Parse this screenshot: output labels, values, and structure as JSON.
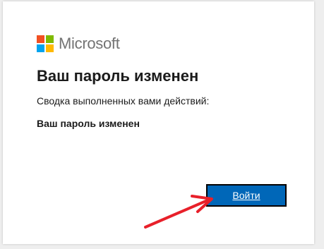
{
  "brand": {
    "name": "Microsoft",
    "colors": {
      "red": "#f25022",
      "green": "#7fba00",
      "blue": "#00a4ef",
      "yellow": "#ffb900"
    }
  },
  "main": {
    "title": "Ваш пароль изменен",
    "summary_label": "Сводка выполненных вами действий:",
    "action_item": "Ваш пароль изменен"
  },
  "buttons": {
    "signin_label": "Войти"
  },
  "annotation": {
    "arrow_icon": "red-arrow-icon",
    "arrow_color": "#e8202a"
  },
  "theme": {
    "accent": "#0067b8"
  }
}
